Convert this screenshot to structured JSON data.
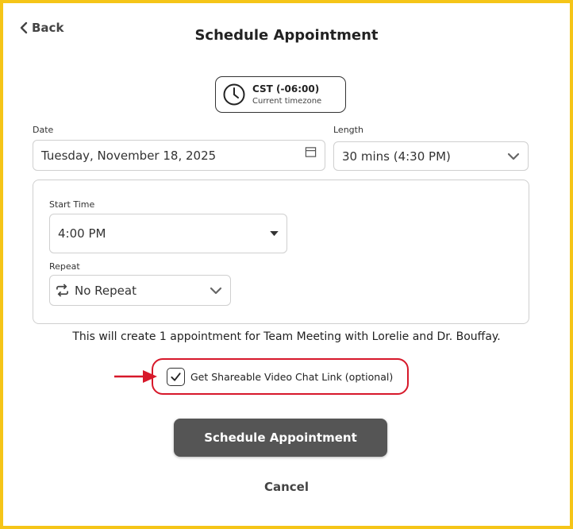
{
  "header": {
    "back_label": "Back",
    "title": "Schedule Appointment"
  },
  "timezone": {
    "name": "CST (-06:00)",
    "caption": "Current timezone",
    "icon": "clock-icon"
  },
  "date": {
    "label": "Date",
    "value": "Tuesday, November 18, 2025",
    "icon": "calendar-icon"
  },
  "length": {
    "label": "Length",
    "value": "30 mins (4:30 PM)",
    "icon": "chevron-down-icon"
  },
  "start_time": {
    "label": "Start Time",
    "value": "4:00 PM",
    "icon": "caret-down-icon"
  },
  "repeat": {
    "label": "Repeat",
    "value": "No Repeat",
    "icon": "repeat-icon"
  },
  "summary": "This will create 1 appointment for Team Meeting with Lorelie and Dr. Bouffay.",
  "video_link": {
    "label": "Get Shareable Video Chat Link (optional)",
    "checked": true
  },
  "actions": {
    "submit_label": "Schedule Appointment",
    "cancel_label": "Cancel"
  },
  "colors": {
    "frame": "#f5c518",
    "primary_button": "#555555",
    "highlight": "#d7182a"
  }
}
